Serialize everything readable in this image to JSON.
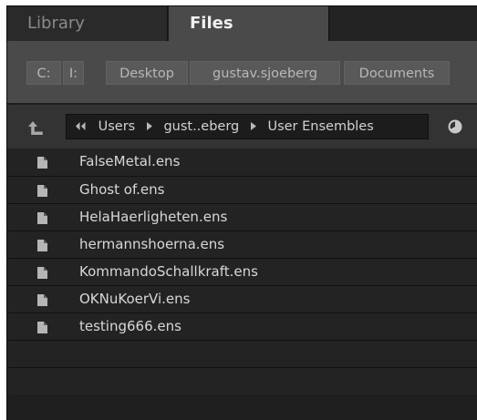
{
  "tabs": [
    {
      "label": "Library",
      "active": false
    },
    {
      "label": "Files",
      "active": true
    }
  ],
  "favorites": [
    {
      "label": "C:"
    },
    {
      "label": "I:"
    },
    {
      "label": "Desktop"
    },
    {
      "label": "gustav.sjoeberg"
    },
    {
      "label": "Documents"
    }
  ],
  "path": {
    "back_icon": "double-chevron-left-icon",
    "segments": [
      "Users",
      "gust..eberg",
      "User Ensembles"
    ],
    "separator_icon": "chevron-right-icon"
  },
  "icons": {
    "up": "arrow-up-icon",
    "history": "clock-icon",
    "file": "file-icon"
  },
  "files": [
    {
      "name": "FalseMetal.ens"
    },
    {
      "name": "Ghost of.ens"
    },
    {
      "name": "HelaHaerligheten.ens"
    },
    {
      "name": "hermannshoerna.ens"
    },
    {
      "name": "KommandoSchallkraft.ens"
    },
    {
      "name": "OKNuKoerVi.ens"
    },
    {
      "name": "testing666.ens"
    }
  ],
  "colors": {
    "background": "#232323",
    "tab_active": "#4a4a4a",
    "crumb_button": "#595959",
    "text": "#d8d8d8"
  }
}
